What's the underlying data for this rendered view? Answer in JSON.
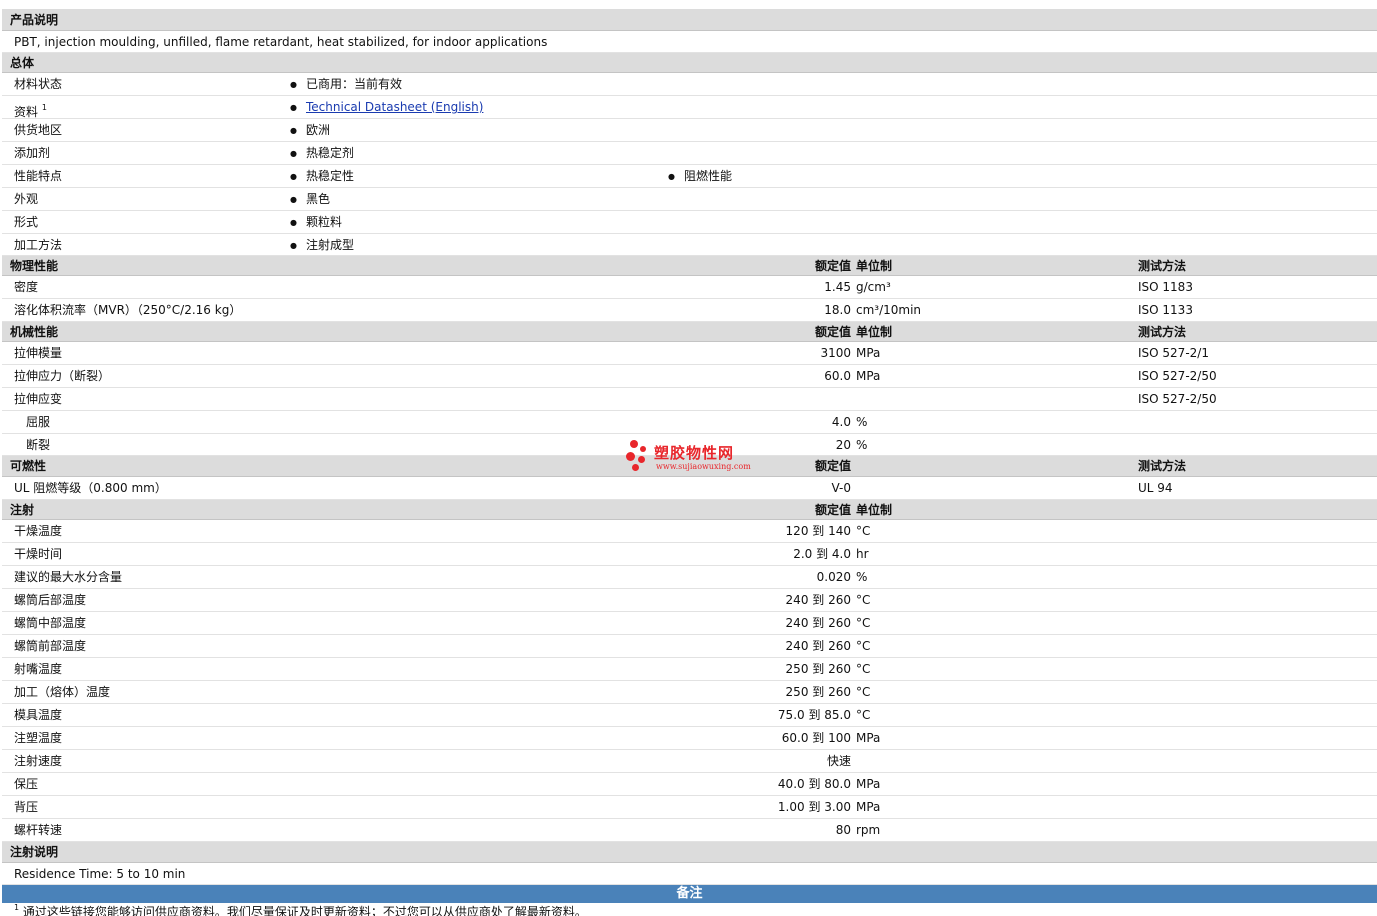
{
  "product_desc": {
    "header": "产品说明",
    "text": "PBT, injection moulding, unfilled, flame retardant, heat stabilized, for indoor applications"
  },
  "general": {
    "header": "总体",
    "rows": [
      {
        "label": "材料状态",
        "values": [
          "已商用：当前有效"
        ]
      },
      {
        "label": "资料",
        "sup": "1",
        "link": "Technical Datasheet (English)"
      },
      {
        "label": "供货地区",
        "values": [
          "欧洲"
        ]
      },
      {
        "label": "添加剂",
        "values": [
          "热稳定剂"
        ]
      },
      {
        "label": "性能特点",
        "values": [
          "热稳定性",
          "阻燃性能"
        ]
      },
      {
        "label": "外观",
        "values": [
          "黑色"
        ]
      },
      {
        "label": "形式",
        "values": [
          "颗粒料"
        ]
      },
      {
        "label": "加工方法",
        "values": [
          "注射成型"
        ]
      }
    ]
  },
  "physical": {
    "header": "物理性能",
    "col_value": "额定值",
    "col_unit": "单位制",
    "col_method": "测试方法",
    "rows": [
      {
        "label": "密度",
        "value": "1.45",
        "unit": "g/cm³",
        "method": "ISO 1183"
      },
      {
        "label": "溶化体积流率（MVR）（250°C/2.16 kg）",
        "value": "18.0",
        "unit": "cm³/10min",
        "method": "ISO 1133"
      }
    ]
  },
  "mechanical": {
    "header": "机械性能",
    "col_value": "额定值",
    "col_unit": "单位制",
    "col_method": "测试方法",
    "rows": [
      {
        "label": "拉伸模量",
        "value": "3100",
        "unit": "MPa",
        "method": "ISO 527-2/1"
      },
      {
        "label": "拉伸应力（断裂）",
        "value": "60.0",
        "unit": "MPa",
        "method": "ISO 527-2/50"
      },
      {
        "label": "拉伸应变",
        "value": "",
        "unit": "",
        "method": "ISO 527-2/50"
      },
      {
        "label": "屈服",
        "value": "4.0",
        "unit": "%",
        "method": "",
        "sub": true
      },
      {
        "label": "断裂",
        "value": "20",
        "unit": "%",
        "method": "",
        "sub": true
      }
    ]
  },
  "flammability": {
    "header": "可燃性",
    "col_value": "额定值",
    "col_method": "测试方法",
    "rows": [
      {
        "label": "UL 阻燃等级（0.800 mm）",
        "value": "V-0",
        "unit": "",
        "method": "UL 94"
      }
    ]
  },
  "injection": {
    "header": "注射",
    "col_value": "额定值",
    "col_unit": "单位制",
    "rows": [
      {
        "label": "干燥温度",
        "value": "120 到  140",
        "unit": "°C"
      },
      {
        "label": "干燥时间",
        "value": "2.0 到  4.0",
        "unit": "hr"
      },
      {
        "label": "建议的最大水分含量",
        "value": "0.020",
        "unit": "%"
      },
      {
        "label": "螺筒后部温度",
        "value": "240 到  260",
        "unit": "°C"
      },
      {
        "label": "螺筒中部温度",
        "value": "240 到  260",
        "unit": "°C"
      },
      {
        "label": "螺筒前部温度",
        "value": "240 到  260",
        "unit": "°C"
      },
      {
        "label": "射嘴温度",
        "value": "250 到  260",
        "unit": "°C"
      },
      {
        "label": "加工（熔体）温度",
        "value": "250 到  260",
        "unit": "°C"
      },
      {
        "label": "模具温度",
        "value": "75.0 到  85.0",
        "unit": "°C"
      },
      {
        "label": "注塑温度",
        "value": "60.0 到  100",
        "unit": "MPa"
      },
      {
        "label": "注射速度",
        "value": "快速",
        "unit": ""
      },
      {
        "label": "保压",
        "value": "40.0 到  80.0",
        "unit": "MPa"
      },
      {
        "label": "背压",
        "value": "1.00 到  3.00",
        "unit": "MPa"
      },
      {
        "label": "螺杆转速",
        "value": "80",
        "unit": "rpm"
      }
    ]
  },
  "injection_notes": {
    "header": "注射说明",
    "text": "Residence Time: 5 to 10 min"
  },
  "notes": {
    "header": "备注",
    "footnote_num": "1",
    "footnote": "通过这些链接您能够访问供应商资料。我们尽量保证及时更新资料；不过您可以从供应商处了解最新资料。"
  },
  "watermark": {
    "title": "塑胶物性网",
    "url": "www.sujiaowuxing.com"
  },
  "colors": {
    "section_bg": "#dcdcdc",
    "notes_bar": "#4a82b9",
    "link": "#1a3bb0",
    "watermark": "#e8262b"
  }
}
